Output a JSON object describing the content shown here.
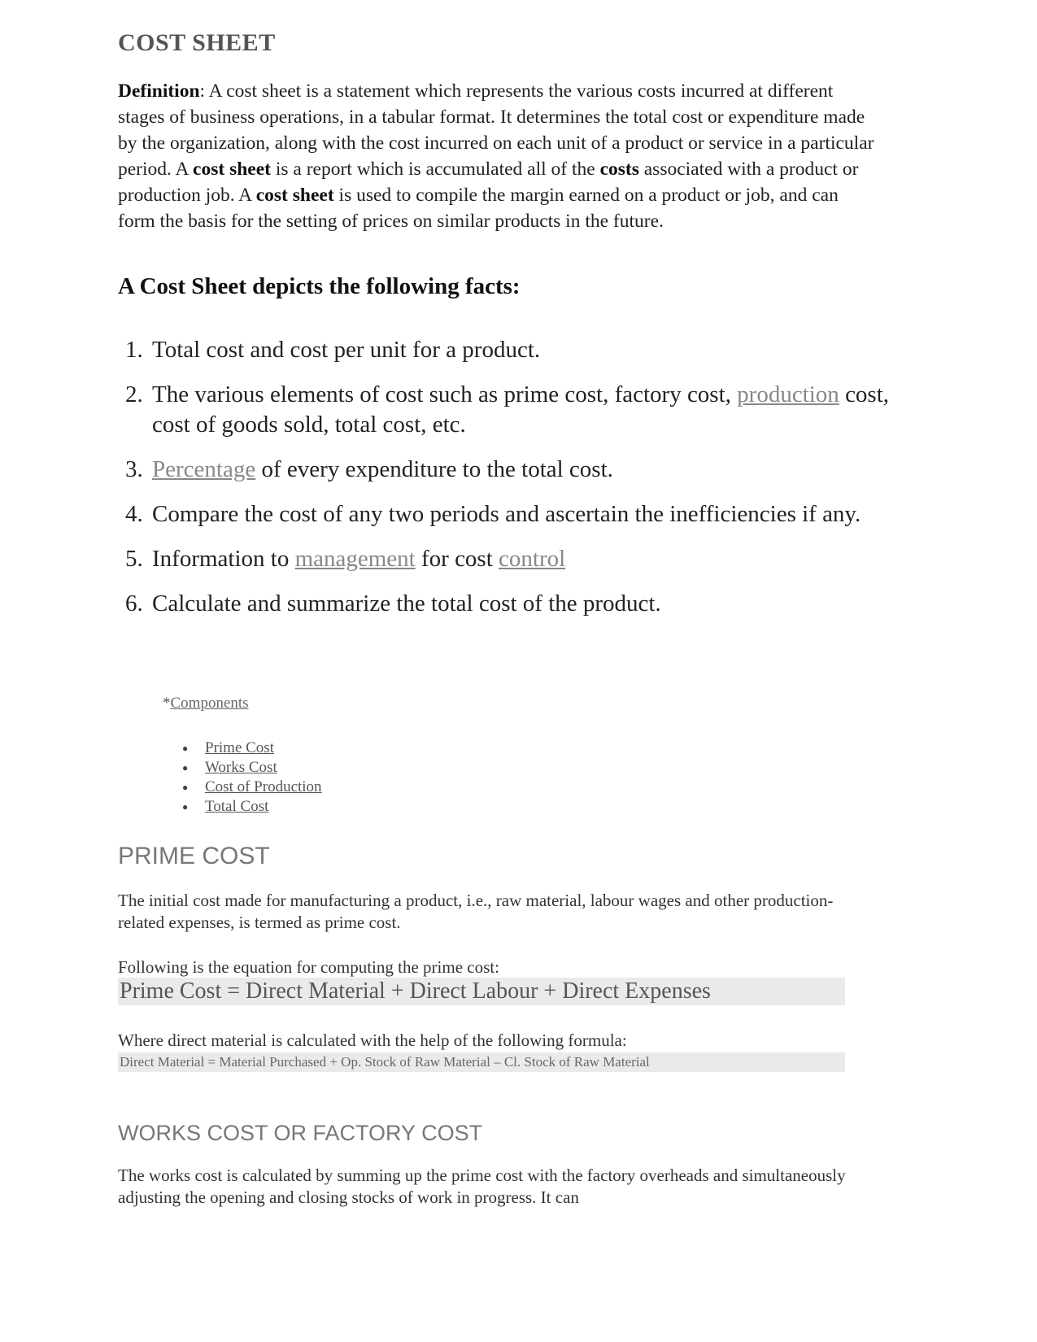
{
  "document": {
    "title": "COST SHEET",
    "definition": {
      "label": "Definition",
      "segments": [
        {
          "text": ": A cost sheet is a statement which represents the various costs incurred at different stages of business operations, in a tabular format. It determines the total cost or expenditure made by the organization, along with the cost incurred on each unit of a product or service in a particular period. A ",
          "bold": false
        },
        {
          "text": "cost sheet",
          "bold": true
        },
        {
          "text": " is a report  which is accumulated all of the ",
          "bold": false
        },
        {
          "text": "costs",
          "bold": true
        },
        {
          "text": " associated with a product or production job. A ",
          "bold": false
        },
        {
          "text": "cost sheet",
          "bold": true
        },
        {
          "text": " is used to compile the margin earned on a product or job, and can form the basis for the setting of prices on similar products in the future.",
          "bold": false
        }
      ]
    },
    "facts_heading": "A Cost Sheet depicts the following facts:",
    "facts": [
      {
        "parts": [
          {
            "text": "Total cost and cost per unit for a product."
          }
        ]
      },
      {
        "parts": [
          {
            "text": "The various elements of cost such as prime cost, factory cost, "
          },
          {
            "text": "production",
            "link": true
          },
          {
            "text": " cost, cost of goods sold, total cost, etc."
          }
        ]
      },
      {
        "parts": [
          {
            "text": "Percentage",
            "link": true
          },
          {
            "text": " of every expenditure to the total cost."
          }
        ]
      },
      {
        "parts": [
          {
            "text": "Compare the cost of any two periods and ascertain the inefficiencies if any."
          }
        ]
      },
      {
        "parts": [
          {
            "text": "Information to "
          },
          {
            "text": "management",
            "link": true
          },
          {
            "text": " for cost "
          },
          {
            "text": "control",
            "link": true
          }
        ]
      },
      {
        "parts": [
          {
            "text": "Calculate and summarize the total cost of the product."
          }
        ]
      }
    ],
    "components": {
      "prefix": "*",
      "label": "Components",
      "items": [
        "Prime Cost",
        "Works Cost",
        "Cost of Production",
        "Total Cost"
      ]
    },
    "prime_cost": {
      "heading": "PRIME COST",
      "intro": "The initial cost made for manufacturing a product, i.e., raw material, labour wages and other production-related expenses, is termed as prime cost.",
      "equation_intro": "Following is the equation for computing the prime cost:",
      "equation": "Prime Cost = Direct Material + Direct Labour + Direct Expenses",
      "dm_intro": "Where direct material is calculated with the help of the following formula:",
      "dm_formula": "Direct Material = Material Purchased + Op. Stock of Raw Material – Cl. Stock of Raw Material"
    },
    "works_cost": {
      "heading": "WORKS COST OR FACTORY COST",
      "intro": "The works cost is calculated by summing up the prime cost with the factory overheads and simultaneously adjusting the opening and closing stocks of work in progress. It can"
    }
  }
}
